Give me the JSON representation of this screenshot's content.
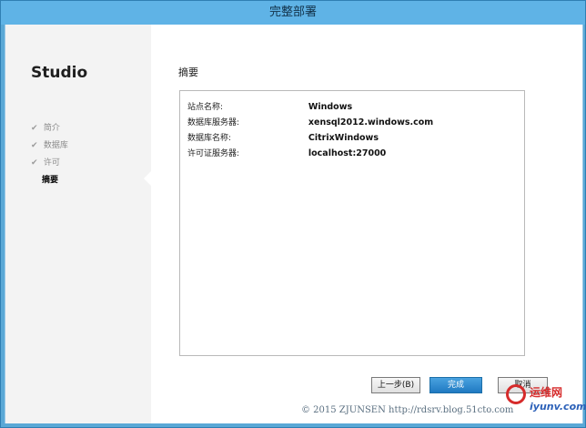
{
  "window": {
    "title": "完整部署"
  },
  "sidebar": {
    "app_name": "Studio",
    "items": [
      {
        "label": "简介",
        "done": true
      },
      {
        "label": "数据库",
        "done": true
      },
      {
        "label": "许可",
        "done": true
      },
      {
        "label": "摘要",
        "done": false,
        "active": true
      }
    ]
  },
  "main": {
    "section_title": "摘要",
    "summary": [
      {
        "label": "站点名称:",
        "value": "Windows"
      },
      {
        "label": "数据库服务器:",
        "value": "xensql2012.windows.com"
      },
      {
        "label": "数据库名称:",
        "value": "CitrixWindows"
      },
      {
        "label": "许可证服务器:",
        "value": "localhost:27000"
      }
    ]
  },
  "buttons": {
    "back": "上一步(B)",
    "finish": "完成",
    "cancel": "取消"
  },
  "watermark": {
    "text": "© 2015 ZJUNSEN http://rdsrv.blog.51cto.com"
  },
  "logo": {
    "line1": "运维网",
    "line2": "iyunv.com"
  },
  "colors": {
    "titlebar": "#5fb3e6",
    "accent": "#1f79c1"
  }
}
